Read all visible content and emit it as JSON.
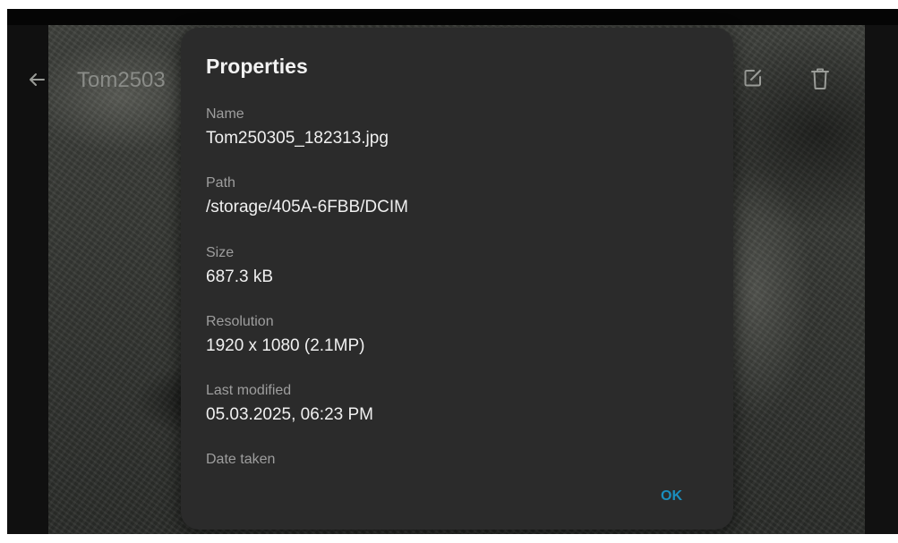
{
  "topbar": {
    "title": "Tom2503",
    "back_icon": "arrow-left-icon",
    "edit_icon": "edit-icon",
    "delete_icon": "trash-icon"
  },
  "dialog": {
    "title": "Properties",
    "properties": [
      {
        "label": "Name",
        "value": "Tom250305_182313.jpg"
      },
      {
        "label": "Path",
        "value": "/storage/405A-6FBB/DCIM"
      },
      {
        "label": "Size",
        "value": "687.3 kB"
      },
      {
        "label": "Resolution",
        "value": "1920 x 1080 (2.1MP)"
      },
      {
        "label": "Last modified",
        "value": "05.03.2025, 06:23 PM"
      },
      {
        "label": "Date taken",
        "value": ""
      }
    ],
    "ok_label": "OK"
  },
  "colors": {
    "dialog_background": "#2b2b2b",
    "accent": "#1a8fbf",
    "label_text": "#9e9e9e",
    "value_text": "#f0f0f0"
  }
}
